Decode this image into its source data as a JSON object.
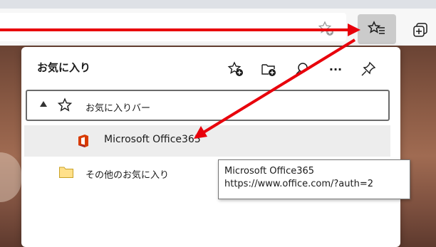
{
  "browser": {
    "favorites_button_icon": "favorites-list-icon",
    "address_star_icon": "add-favorite-star-icon",
    "collections_icon": "collections-icon"
  },
  "favorites_panel": {
    "title": "お気に入り",
    "header_icons": [
      "add-favorite-icon",
      "add-folder-icon",
      "search-icon",
      "more-icon",
      "pin-icon"
    ],
    "more_label": "···",
    "tree": {
      "favorites_bar": {
        "label": "お気に入りバー",
        "expanded": true
      },
      "office_item": {
        "label": "Microsoft Office365"
      },
      "other_folder": {
        "label": "その他のお気に入り"
      }
    }
  },
  "tooltip": {
    "title": "Microsoft Office365",
    "url": "https://www.office.com/?auth=2"
  },
  "annotation_color": "#e8000b"
}
